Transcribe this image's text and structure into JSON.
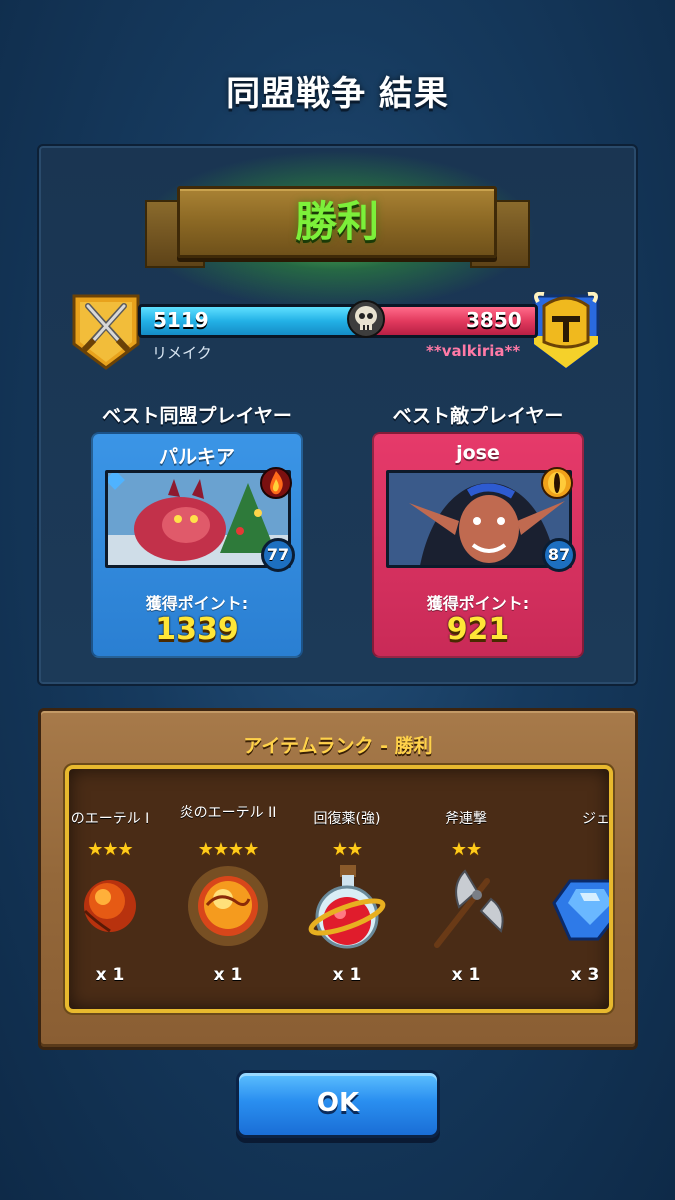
{
  "header": {
    "title": "同盟戦争 結果"
  },
  "result": {
    "label": "勝利"
  },
  "score": {
    "ally_score": "5119",
    "enemy_score": "3850",
    "ally_fraction": 0.571,
    "ally_team": "リメイク",
    "enemy_team": "**valkiria**"
  },
  "best": {
    "ally_heading": "ベスト同盟プレイヤー",
    "enemy_heading": "ベスト敵プレイヤー",
    "ally": {
      "name": "パルキア",
      "level": "77",
      "points_label": "獲得ポイント:",
      "points": "1339"
    },
    "enemy": {
      "name": "jose",
      "level": "87",
      "points_label": "獲得ポイント:",
      "points": "921"
    }
  },
  "items_panel": {
    "title": "アイテムランク - 勝利",
    "items": [
      {
        "name": "のエーテル I",
        "stars": "★★★",
        "qty": "x 1",
        "icon": "fire-ether-icon"
      },
      {
        "name": "炎のエーテル II",
        "stars": "★★★★",
        "qty": "x 1",
        "icon": "fire-ether-icon"
      },
      {
        "name": "回復薬(強)",
        "stars": "★★",
        "qty": "x 1",
        "icon": "potion-icon"
      },
      {
        "name": "斧連撃",
        "stars": "★★",
        "qty": "x 1",
        "icon": "battle-axe-icon"
      },
      {
        "name": "ジェム",
        "stars": "",
        "qty": "x 3",
        "icon": "gem-icon"
      }
    ]
  },
  "ok_button": {
    "label": "OK"
  },
  "colors": {
    "ally": "#23b1e6",
    "enemy": "#e23a5e",
    "victory": "#7cf03a",
    "points": "#ffe637"
  }
}
